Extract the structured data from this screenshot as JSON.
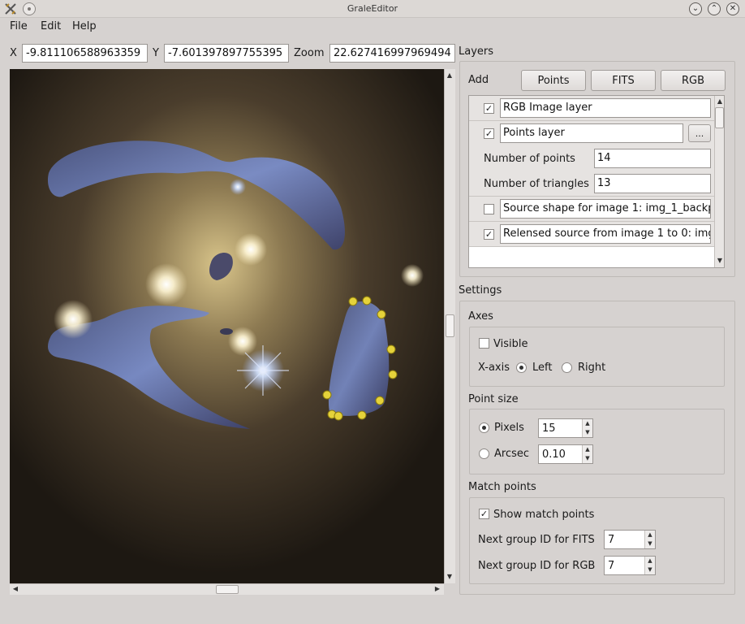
{
  "window": {
    "title": "GraleEditor"
  },
  "menu": {
    "file": "File",
    "edit": "Edit",
    "help": "Help"
  },
  "coords": {
    "x_label": "X",
    "x_value": "-9.811106588963359",
    "y_label": "Y",
    "y_value": "-7.601397897755395",
    "zoom_label": "Zoom",
    "zoom_value": "22.627416997969494"
  },
  "layers": {
    "title": "Layers",
    "add_label": "Add",
    "add_points": "Points",
    "add_fits": "FITS",
    "add_rgb": "RGB",
    "items": [
      {
        "name": "RGB Image layer",
        "checked": true
      },
      {
        "name": "Points layer",
        "checked": true,
        "more": "...",
        "num_points_label": "Number of points",
        "num_points": "14",
        "num_triangles_label": "Number of triangles",
        "num_triangles": "13"
      },
      {
        "name": "Source shape for image 1: img_1_backp",
        "checked": false
      },
      {
        "name": "Relensed source from image 1 to 0: img",
        "checked": true
      }
    ]
  },
  "settings": {
    "title": "Settings",
    "axes": {
      "title": "Axes",
      "visible_label": "Visible",
      "visible": false,
      "xaxis_label": "X-axis",
      "left": "Left",
      "right": "Right",
      "selected": "Left"
    },
    "point_size": {
      "title": "Point size",
      "pixels_label": "Pixels",
      "pixels_value": "15",
      "arcsec_label": "Arcsec",
      "arcsec_value": "0.10",
      "selected": "Pixels"
    },
    "match_points": {
      "title": "Match points",
      "show_label": "Show match points",
      "show": true,
      "fits_label": "Next group ID for FITS",
      "fits_value": "7",
      "rgb_label": "Next group ID for RGB",
      "rgb_value": "7"
    }
  },
  "colors": {
    "background": "#d6d2d0",
    "point_marker": "#e5d23a",
    "arc": "#6f83c8"
  }
}
